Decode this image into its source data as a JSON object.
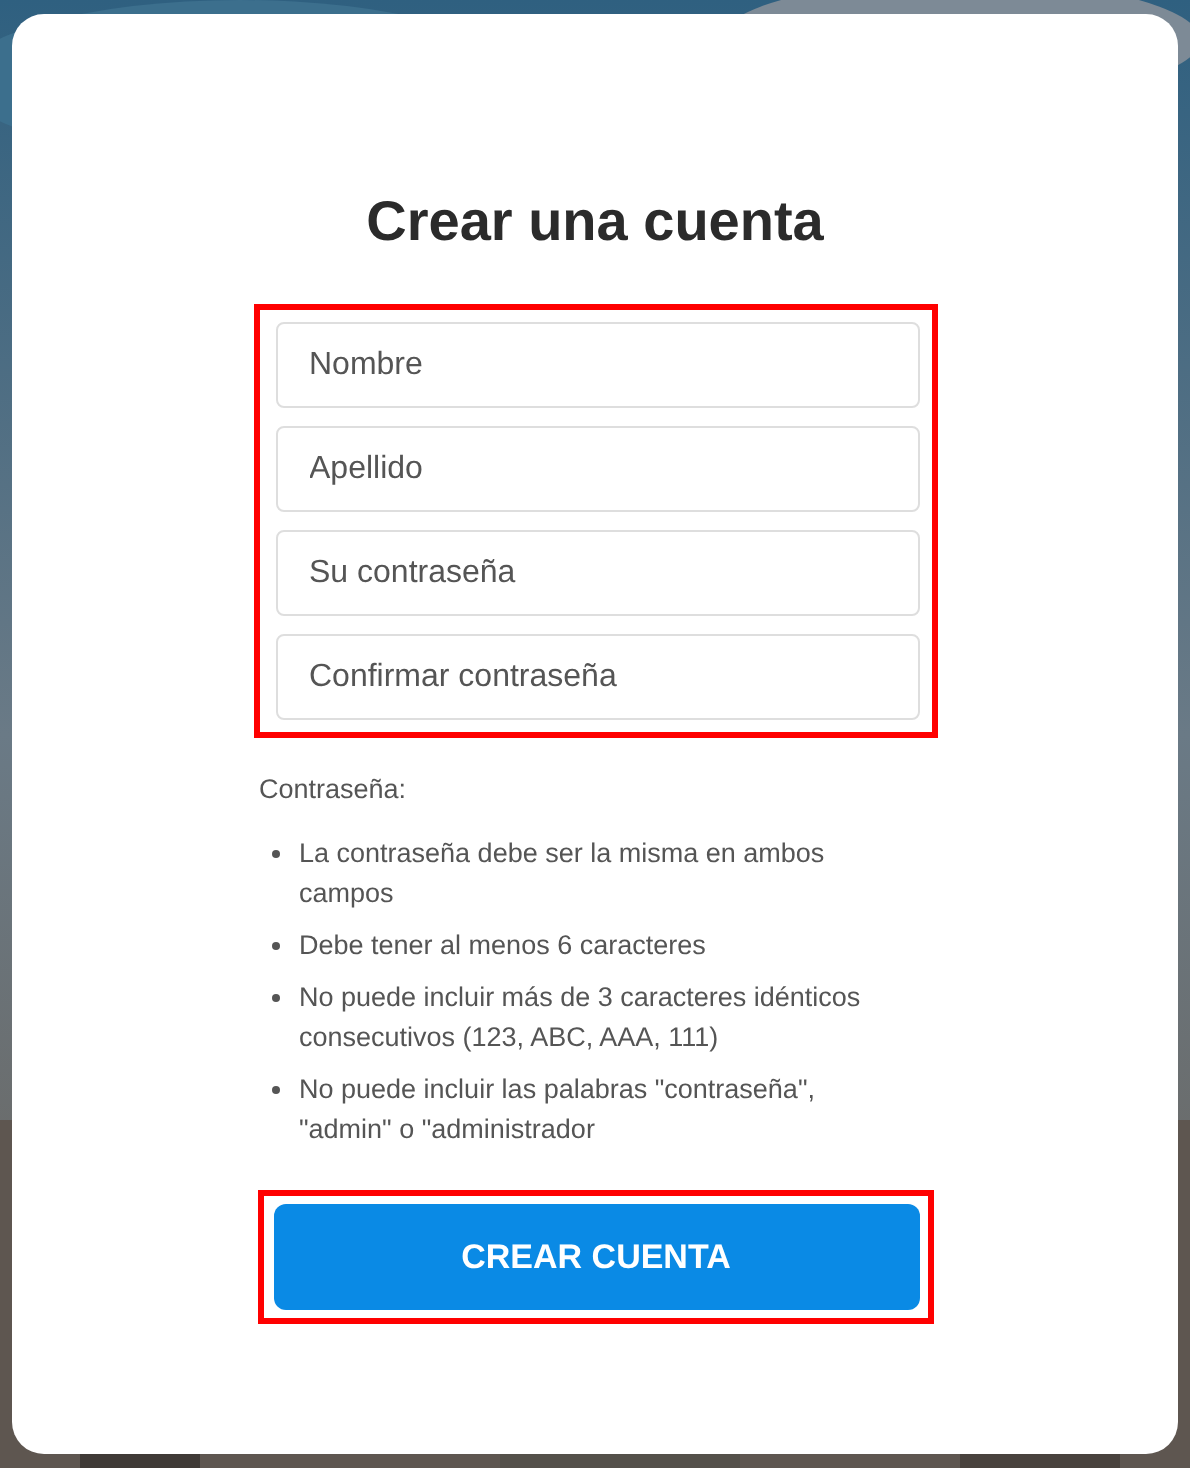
{
  "title": "Crear una cuenta",
  "fields_group": {
    "highlighted": true,
    "fields": [
      {
        "placeholder": "Nombre"
      },
      {
        "placeholder": "Apellido"
      },
      {
        "placeholder": "Su contraseña"
      },
      {
        "placeholder": "Confirmar contraseña"
      }
    ]
  },
  "password_rules": {
    "heading": "Contraseña:",
    "items": [
      "La contraseña debe ser la misma en ambos campos",
      "Debe tener al menos 6 caracteres",
      "No puede incluir más de 3 caracteres idénticos consecutivos (123, ABC, AAA, 111)",
      "No puede incluir las palabras \"contraseña\", \"admin\" o \"administrador"
    ]
  },
  "submit": {
    "label": "CREAR CUENTA",
    "highlighted": true
  }
}
